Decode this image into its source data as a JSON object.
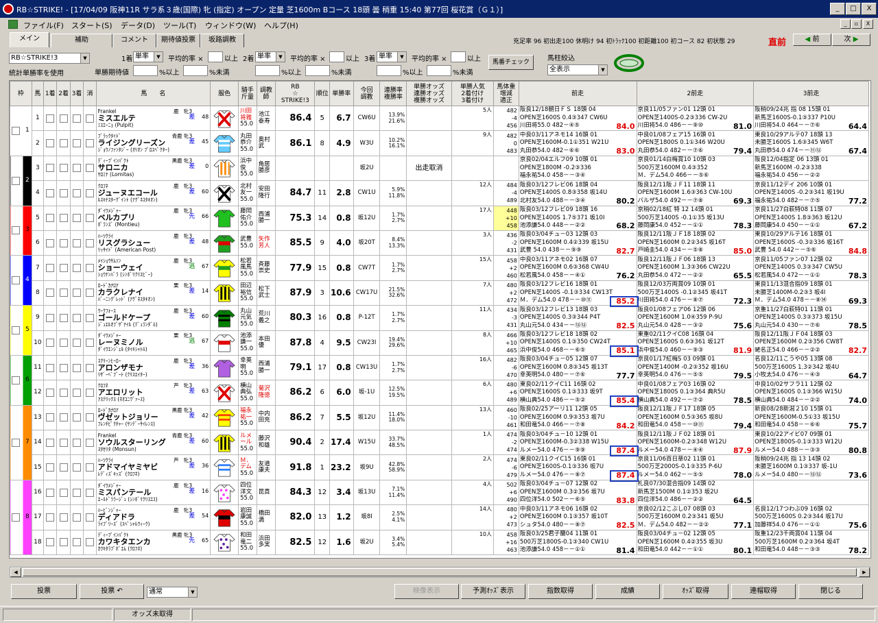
{
  "window": {
    "title": "RB☆STRIKE! - [17/04/09 阪神11R サラ系３歳(国際) 牝 (指定) オープン 定量 芝1600m Bコース 18頭 曇 稍重 15:40 第77回 桜花賞（Ｇ１）]",
    "min": "_",
    "max": "□",
    "close": "X"
  },
  "menu": [
    "ファイル(F)",
    "スタート(S)",
    "データ(D)",
    "ツール(T)",
    "ウィンドウ(W)",
    "ヘルプ(H)"
  ],
  "mdi": {
    "min": "_",
    "restore": "▫",
    "close": "X"
  },
  "tabs": [
    "メイン",
    "補助",
    "コメント",
    "期待値投票",
    "坂路調教"
  ],
  "stats": "充足率 96  初出走100 休明け 94  初ﾄﾗｯｸ100  初距離100  初コース 82  初状態 29",
  "chokuzen": "直前",
  "nav": {
    "prev": "前",
    "next": "次"
  },
  "controls": {
    "profile": "RB☆STRIKE!3",
    "stat_label": "統計単勝率を使用",
    "c1_label": "1着",
    "c1_sel": "単率",
    "c2_label": "2着",
    "c2_sel": "単率",
    "c3_label": "3着",
    "c3_sel": "単率",
    "avg_label": "平均的率 ×",
    "above": "以上",
    "tan_exp": "単勝期待値",
    "pct_above": "%以上",
    "pct_below": "%未満",
    "umaban_check": "馬番チェック",
    "filter_label": "馬柱絞込",
    "filter_value": "全表示"
  },
  "headers": [
    "枠",
    "馬",
    "1着",
    "2着",
    "3着",
    "消",
    "馬　　名",
    "服色",
    "騎手\n斤量",
    "調教\n師",
    "RB\n☆\nSTRIKE!3",
    "順位",
    "単勝率",
    "今回\n調教",
    "連勝率\n複勝率",
    "単勝オッズ\n連勝オッズ\n複勝オッズ",
    "単勝人気\n2着付け\n3着付け",
    "馬体重\n増減\n適正",
    "前走",
    "2前走",
    "3前走"
  ],
  "horses": [
    {
      "waku": "1",
      "ban": "1",
      "sire": "Frankel",
      "sexage": "鹿　牝3",
      "name": "ミスエルテ",
      "dam": "ﾐｽｴｰﾆｮ (Pulpit)",
      "style": "差",
      "ft": "48",
      "jockey": "川田\n将雅",
      "jred": true,
      "weight": "55.0",
      "trainer": "池江\n泰寿",
      "rb": "86.4",
      "jun": "5",
      "odds": "6.7",
      "chou": "CW6U",
      "rate": "13.9%\n21.6%",
      "cancel": "",
      "ninki": "5人",
      "bw": "482\n-4\n456",
      "bwy": false,
      "p1": [
        "阪良12/18朝日ＦＳ 18頭 04",
        "OPEN芝1600S 0.4③347 CW6U",
        "川田将55.0 482－④⑤ 84.0"
      ],
      "p1s": "84.0",
      "p1r": true,
      "p2": [
        "京良11/05ファン01 12頭 01",
        "OPEN芝1400S-0.2③336 CW-2U",
        "川田将54.0 486－－⑨⑩ 81.0"
      ],
      "p2s": "81.0",
      "p2r": false,
      "p3": [
        "阪稍09/24兆 指 08 15頭 01",
        "新馬芝1600S-0.1③337 P10U",
        "川田将54.0 464－－⑦⑥ 64.4"
      ],
      "p3s": "64.4",
      "p3r": false,
      "silk": "red-x"
    },
    {
      "waku": "1",
      "ban": "2",
      "sire": "ﾌﾞﾗｯｸﾀｲﾄﾞ",
      "sexage": "青鹿 牝3",
      "name": "ライジングリーズン",
      "dam": "ｼﾞｮｳﾉﾌｧﾝﾀｼﾞｰ (ｵﾘｵﾝ ﾌﾟﾛｽﾍﾟｸﾀｰ)",
      "style": "差",
      "ft": "45",
      "jockey": "丸田\n恭介",
      "jred": false,
      "weight": "55.0",
      "trainer": "奥村\n武",
      "rb": "86.1",
      "jun": "8",
      "odds": "4.9",
      "chou": "W3U",
      "rate": "10.2%\n16.1%",
      "cancel": "",
      "ninki": "9人",
      "bw": "482\n0\n483",
      "bwy": false,
      "p1": [
        "中良03/11アネモ14 16頭 01",
        "OPEN芝1600M-0.1①351 W21U",
        "丸田恭54.0 482－⑥⑥ 83.0"
      ],
      "p1s": "83.0",
      "p1r": true,
      "p2": [
        "中良01/08フェア15 16頭 01",
        "OPEN芝1800S 0.1①346 W20U",
        "丸田恭54.0 482－－⑦⑥ 79.4"
      ],
      "p2s": "79.4",
      "p2r": false,
      "p3": [
        "東良10/29アルテ07 18頭 13",
        "未勝芝1600S 1.6③345 W6T",
        "丸田恭54.0 474－－⑪⑫ 67.4"
      ],
      "p3s": "67.4",
      "p3r": false,
      "silk": "lightblue"
    },
    {
      "waku": "2",
      "ban": "3",
      "sire": "ﾃﾞｨｰﾌﾟｲﾝﾊﾟｸﾄ",
      "sexage": "黒鹿 牝3",
      "name": "サロニカ",
      "dam": "ｻﾛﾐﾅ (Lomitas)",
      "style": "差",
      "ft": "0",
      "jockey": "浜中\n俊",
      "jred": false,
      "weight": "55.0",
      "trainer": "角居\n勝彦",
      "rb": "",
      "jun": "",
      "odds": "",
      "chou": "坂2U",
      "rate": "",
      "cancel": "出走取消",
      "ninki": "",
      "bw": "",
      "bwy": false,
      "p1": [
        "京良02/04エルフ09 10頭 01",
        "OPEN芝1800M -0.2③336",
        "福永祐54.0 458－－③④"
      ],
      "p1s": "",
      "p1r": false,
      "p2": [
        "京良01/14白梅賞10 10頭 03",
        "500万芝1600M 0.4③352",
        "Ｍ．デム54.0 466－－⑤⑥"
      ],
      "p2s": "",
      "p2r": false,
      "p3": [
        "阪良12/04指定 06 13頭 01",
        "新馬芝1600M -0.2③338",
        "福永祐54.0 456－－②②"
      ],
      "p3s": "",
      "p3r": false,
      "silk": "orange-stripe"
    },
    {
      "waku": "2",
      "ban": "4",
      "sire": "ｸﾛﾌﾈ",
      "sexage": "鹿　牝3",
      "name": "ジューヌエコール",
      "dam": "ﾙｽｷﾅｽﾀｰｸﾞｲﾝﾄ (ｱｸﾞﾈｽﾀｷｵﾝ)",
      "style": "差",
      "ft": "60",
      "jockey": "北村\n友一",
      "jred": false,
      "weight": "55.0",
      "trainer": "安田\n隆行",
      "rb": "84.7",
      "jun": "11",
      "odds": "2.8",
      "chou": "CW1U",
      "rate": "5.9%\n11.8%",
      "cancel": "",
      "ninki": "12人",
      "bw": "484\n-4\n489",
      "bwy": false,
      "p1": [
        "阪良03/12フレビ06 18頭 04",
        "OPEN芝1400S 0.8③358 坂14U",
        "北村友54.0 488－－③④ 80.2"
      ],
      "p1s": "80.2",
      "p1r": false,
      "p2": [
        "阪良12/11阪ＪＦ11 18頭 11",
        "OPEN芝1600M 1.6③363 CW-10U",
        "バルザ54.0 492－－⑦⑧ 69.3"
      ],
      "p2s": "69.3",
      "p2r": false,
      "p3": [
        "京良11/12デイ 206 10頭 01",
        "OPEN芝1400S -0.2③341 坂19U",
        "福永祐54.0 482－－⑦⑤ 77.2"
      ],
      "p3s": "77.2",
      "p3r": false,
      "silk": "black-x"
    },
    {
      "waku": "3",
      "ban": "5",
      "sire": "ﾀﾞｲﾜﾒｼﾞｬｰ",
      "sexage": "鹿　牝3",
      "name": "ベルカプリ",
      "dam": "ﾎﾟﾗﾝｽﾞ (Montieu)",
      "style": "先",
      "ft": "66",
      "jockey": "藤岡\n佑介",
      "jred": false,
      "weight": "55.0",
      "trainer": "西浦\n勝一",
      "rb": "75.3",
      "jun": "14",
      "odds": "0.8",
      "chou": "坂12U",
      "rate": "1.7%\n2.7%",
      "cancel": "",
      "ninki": "17人",
      "bw": "448\n+10\n458",
      "bwy": true,
      "p1": [
        "阪良03/12フレビ09 18頭 16",
        "OPEN芝1400S 1.7⑤371 坂10I",
        "池添謙54.0 448－－②② 68.2"
      ],
      "p1s": "68.2",
      "p1r": false,
      "p2": [
        "京稍02/18紅 特 12 14頭 01",
        "500万芝1400S -0.1①35 坂13U",
        "藤岡康54.0 452－－①① 78.3"
      ],
      "p2s": "78.3",
      "p2r": false,
      "p3": [
        "京良11/27白萩特08 11頭 07",
        "OPEN芝1400S 1.8③363 坂12U",
        "藤岡康54.0 450－－①① 67.2"
      ],
      "p3s": "67.2",
      "p3r": false,
      "silk": "green"
    },
    {
      "waku": "3",
      "ban": "6",
      "sire": "ﾊｰﾂｸﾗｲ",
      "sexage": "鹿　牝3",
      "name": "リスグラシュー",
      "dam": "ﾘｯｻｲﾄﾞ (American Post)",
      "style": "差",
      "ft": "48",
      "jockey": "武豊",
      "jred": false,
      "weight": "55.0",
      "trainer": "矢作\n芳人",
      "tred": true,
      "rb": "85.5",
      "jun": "9",
      "odds": "4.0",
      "chou": "坂20T",
      "rate": "8.4%\n13.3%",
      "cancel": "",
      "ninki": "3人",
      "bw": "436\n-2\n431",
      "bwy": false,
      "p1": [
        "阪良03/04チュ－03 12頭 03",
        "OPEN芝1600M 0.4②339 坂15U",
        "武豊 54.0 438－－⑨⑨ 82.7"
      ],
      "p1s": "82.7",
      "p1r": true,
      "p2": [
        "阪良12/11阪ＪＦ18 18頭 02",
        "OPEN芝1600M 0.2②345 坂16T",
        "戸崎圭54.0 434－－⑤⑧ 85.0"
      ],
      "p2s": "85.0",
      "p2r": true,
      "p3": [
        "東良10/29アルテ16 18頭 01",
        "OPEN芝1600S -0.3②336 坂16T",
        "武豊 54.0 442－－⑤⑥ 84.8"
      ],
      "p3s": "84.8",
      "p3r": true,
      "silk": "green-red"
    },
    {
      "waku": "4",
      "ban": "7",
      "sire": "ﾒｲｼｮｳｻﾑｿﾝ",
      "sexage": "鹿　牝3",
      "name": "ショーウェイ",
      "dam": "ｼｮｳﾅﾝﾊﾞﾗ (ｼﾝﾎﾞﾘｸﾘｽﾋﾞｰ)",
      "style": "逃",
      "ft": "67",
      "jockey": "松若\n風馬",
      "jred": false,
      "weight": "55.0",
      "trainer": "斉藤\n崇史",
      "rb": "77.9",
      "jun": "15",
      "odds": "0.8",
      "chou": "CW7T",
      "rate": "1.7%\n2.7%",
      "cancel": "",
      "ninki": "15人",
      "bw": "458\n+2\n460",
      "bwy": false,
      "p1": [
        "中良03/11アネモ02 16頭 07",
        "OPEN芝1600M 0.6③368 CW4U",
        "松若風54.0 458－－④① 76.2"
      ],
      "p1s": "76.2",
      "p1r": false,
      "p2": [
        "阪良12/11阪ＪＦ06 18頭 13",
        "OPEN芝1600M 1.3③366 CW22U",
        "丸田恭54.0 472－－②② 65.5"
      ],
      "p2s": "65.5",
      "p2r": false,
      "p3": [
        "京良11/05ファン07 12頭 02",
        "OPEN芝1400S 0.3③347 CW5U",
        "松若風54.0 472－－①① 78.3"
      ],
      "p3s": "78.3",
      "p3r": false,
      "silk": "yellow-green"
    },
    {
      "waku": "4",
      "ban": "8",
      "sire": "ﾛｰﾄﾞｶﾅﾛｱ",
      "sexage": "栗　牝3",
      "name": "カラクレナイ",
      "dam": "ﾊﾞｰﾆﾝｸﾞﾚｯﾄﾞ (ｱｸﾞﾈｽﾀｷｵﾝ)",
      "style": "差",
      "ft": "14",
      "jockey": "田辺\n裕信",
      "jred": false,
      "weight": "55.0",
      "trainer": "松下\n武士",
      "rb": "87.9",
      "jun": "3",
      "odds": "10.6",
      "chou": "CW17U",
      "rate": "21.5%\n32.6%",
      "cancel": "",
      "ninki": "7人",
      "bw": "480\n+2\n472",
      "bwy": false,
      "p1": [
        "阪良03/12フレビ16 18頭 01",
        "OPEN芝1400S -0.1③334 CW13T",
        "Ｍ．デム54.0 478－－⑩⑪ 85.2"
      ],
      "p1s": "85.2",
      "p1r": true,
      "p2": [
        "阪良12/03万両賞09 10頭 01",
        "500万芝1400S -0.1②345 坂41T",
        "川田将54.0 476－－⑧⑦ 72.3"
      ],
      "p2s": "72.3",
      "p2r": false,
      "p3": [
        "東良11/13混合指09 18頭 01",
        "未勝芝1400M-0.2③3 坂4I",
        "Ｍ．デム54.0 478－－⑧⑭ 69.3"
      ],
      "p3s": "69.3",
      "p3r": false,
      "silk": "yellow-black"
    },
    {
      "waku": "5",
      "ban": "9",
      "sire": "ﾜｰｸﾌｫｰｽ",
      "sexage": "鹿　牝3",
      "name": "ゴールドケープ",
      "dam": "ｼﾞｭｴﾙｵﾌﾞｻﾞﾅｲﾙ (ﾃﾞｭﾗﾝﾀﾞﾙ)",
      "style": "差",
      "ft": "60",
      "jockey": "丸山\n元気",
      "jred": false,
      "weight": "55.0",
      "trainer": "荒川\n義之",
      "rb": "80.3",
      "jun": "16",
      "odds": "0.8",
      "chou": "P-12T",
      "rate": "1.7%\n2.7%",
      "cancel": "",
      "ninki": "11人",
      "bw": "434\n-3\n431",
      "bwy": false,
      "p1": [
        "阪良03/12フレビ13 18頭 03",
        "OPEN芝1400S 0.3③344 P4T",
        "丸山元54.0 434－－⑬⑫ 82.5"
      ],
      "p1s": "82.5",
      "p1r": true,
      "p2": [
        "阪良01/08フェア06 12頭 06",
        "OPEN芝1600M 1.0④359 P-9U",
        "丸山元54.0 428－－③② 75.6"
      ],
      "p2s": "75.6",
      "p2r": false,
      "p3": [
        "京重11/27白萩特01 11頭 01",
        "OPEN芝1400S 0.3③373 坂15U",
        "丸山元54.0 430－－⑦⑥ 78.5"
      ],
      "p3s": "78.5",
      "p3r": false,
      "silk": "green-x"
    },
    {
      "waku": "5",
      "ban": "10",
      "sire": "ﾀﾞｲﾜﾒｼﾞｬｰ",
      "sexage": "栗　牝3",
      "name": "レーヌミノル",
      "dam": "ﾀﾞｲﾜｴﾝｼﾞｪﾙ (ﾀｲｷｼｬﾄﾙ)",
      "style": "逃",
      "ft": "67",
      "jockey": "池添\n謙一",
      "jred": false,
      "weight": "55.0",
      "trainer": "本田\n優",
      "rb": "87.8",
      "jun": "4",
      "odds": "9.5",
      "chou": "CW23I",
      "rate": "19.4%\n29.6%",
      "cancel": "",
      "ninki": "8人",
      "bw": "466\n+10\n465",
      "bwy": false,
      "p1": [
        "阪良03/12フレビ18 18頭 02",
        "OPEN芝1400S 0.1③350 CW24T",
        "浜中俊54.0 468－－⑥⑤ 85.1"
      ],
      "p1s": "85.1",
      "p1r": true,
      "p2": [
        "東重02/11クイC08 16頭 04",
        "OPEN芝1600S 0.6③361 坂12T",
        "浜中俊54.0 460－－⑨③ 81.9"
      ],
      "p2s": "81.9",
      "p2r": true,
      "p3": [
        "阪良12/11阪ＪＦ04 18頭 03",
        "OPEN芝1600M 0.2③356 CW8T",
        "蛯名正54.0 466－－②② 82.7"
      ],
      "p3s": "82.7",
      "p3r": true,
      "silk": "white-red"
    },
    {
      "waku": "6",
      "ban": "11",
      "sire": "ｽｸﾘｰﾝﾋｰﾛｰ",
      "sexage": "鹿　牝3",
      "name": "アロンザモナ",
      "dam": "ﾘｻﾞｰﾍﾞﾌﾞｰﾄ (ｸﾘｽｴｲﾀｰ)",
      "style": "差",
      "ft": "36",
      "jockey": "幸英\n明",
      "jred": false,
      "weight": "55.0",
      "trainer": "西浦\n勝一",
      "rb": "79.1",
      "jun": "17",
      "odds": "0.8",
      "chou": "CW13U",
      "rate": "1.7%\n2.7%",
      "cancel": "",
      "ninki": "16人",
      "bw": "482\n-6\n470",
      "bwy": false,
      "p1": [
        "阪良03/04チュ－05 12頭 07",
        "OPEN芝1600M 0.8③345 坂13T",
        "幸英明54.0 480－－⑦⑥ 77.7"
      ],
      "p1s": "77.7",
      "p1r": false,
      "p2": [
        "京良01/17紅梅S 03 09頭 01",
        "OPEN芝1400M -0.2③352 坂16U",
        "幸英明54.0 476－－⑤⑤ 79.5"
      ],
      "p2s": "79.5",
      "p2r": false,
      "p3": [
        "名良12/11こうや05 13頭 08",
        "500万芝1600S 1.3②342 坂4U",
        "小牧太54.0 476－－④③ 64.7"
      ],
      "p3s": "64.7",
      "p3r": false,
      "silk": "purple"
    },
    {
      "waku": "6",
      "ban": "12",
      "sire": "ｸﾛﾌﾈ",
      "sexage": "芦　牝3",
      "name": "アエロリット",
      "dam": "ｱｽﾃﾘｯｸｽ (ﾈｵﾕﾆｳﾞｧｰｽ)",
      "style": "差",
      "ft": "63",
      "jockey": "横山\n典弘",
      "jred": false,
      "weight": "55.0",
      "trainer": "菊沢\n隆徳",
      "tred": true,
      "rb": "86.2",
      "jun": "6",
      "odds": "6.0",
      "chou": "坂-1U",
      "rate": "12.5%\n19.5%",
      "cancel": "",
      "ninki": "6人",
      "bw": "480\n+6\n489",
      "bwy": false,
      "p1": [
        "東良02/11クイC11 16頭 02",
        "OPEN芝1600S 0.1③333 坂9T",
        "横山典54.0 486－－⑤② 85.4"
      ],
      "p1s": "85.4",
      "p1r": true,
      "p2": [
        "中良01/08フェア03 16頭 02",
        "OPEN芝1800S 0.1③364 典R5U",
        "横山典54.0 492－－⑦② 78.5"
      ],
      "p2s": "78.5",
      "p2r": false,
      "p3": [
        "中良10/02サフラ11 12頭 02",
        "OPEN芝1600S 0.1③366 W15U",
        "横山典54.0 484－－②② 74.0"
      ],
      "p3s": "74.0",
      "p3r": false,
      "silk": "red-x2"
    },
    {
      "waku": "7",
      "ban": "13",
      "sire": "ﾛｰﾄﾞｶﾅﾛｱ",
      "sexage": "黒鹿 牝3",
      "name": "ヴゼットジョリー",
      "dam": "ﾌﾚﾝﾁﾋﾟｸﾁｬｰ (ｻﾝﾃﾞｰｻｲﾚﾝｽ)",
      "style": "差",
      "ft": "42",
      "jockey": "福永\n祐一",
      "jred": true,
      "weight": "55.0",
      "trainer": "中内\n田充",
      "rb": "86.2",
      "jun": "7",
      "odds": "5.5",
      "chou": "坂12U",
      "rate": "11.4%\n18.0%",
      "cancel": "",
      "ninki": "13人",
      "bw": "460\n-10\n461",
      "bwy": false,
      "p1": [
        "阪良02/25アーリ11 12頭 05",
        "OPEN芝1600M 0.9③353 坂7U",
        "和田竜54.0 466－－⑦⑧ 84.2"
      ],
      "p1s": "84.2",
      "p1r": true,
      "p2": [
        "阪良12/11阪ＪＦ17 18頭 05",
        "OPEN芝1600M 0.5③365 坂8U",
        "和田竜54.0 458－－⑩⑪ 79.4"
      ],
      "p2s": "79.4",
      "p2r": false,
      "p3": [
        "新良08/28新潟２10 15頭 01",
        "OPEN芝1600M-0.5①33 坂15U",
        "和田竜54.0 458－－⑥⑥ 75.7"
      ],
      "p3s": "75.7",
      "p3r": false,
      "silk": "yellow-orange"
    },
    {
      "waku": "7",
      "ban": "14",
      "sire": "Frankel",
      "sexage": "青鹿 牝3",
      "name": "ソウルスターリング",
      "dam": "ｽﾀｾﾘﾀ (Monsun)",
      "style": "差",
      "ft": "60",
      "jockey": "ルメ\nール",
      "jred": true,
      "weight": "55.0",
      "trainer": "藤沢\n和雄",
      "rb": "90.4",
      "jun": "2",
      "odds": "17.4",
      "chou": "W15U",
      "rate": "33.7%\n48.5%",
      "cancel": "",
      "ninki": "1人",
      "bw": "474\n-2\n474",
      "bwy": false,
      "p1": [
        "阪良03/04チュ－10 12頭 01",
        "OPEN芝1600M-0.3②338 W15U",
        "ルメー54.0 476－－⑨⑨ 87.4"
      ],
      "p1s": "87.4",
      "p1r": true,
      "p2": [
        "阪良12/11阪ＪＦ02 18頭 01",
        "OPEN芝1600M-0.2③348 W12U",
        "ルメー54.0 478－－④④ 87.9"
      ],
      "p2s": "87.9",
      "p2r": true,
      "p3": [
        "東良10/22アイビ07 09頭 01",
        "OPEN芝1800S-0.1③333 W12U",
        "ルメー54.0 488－－③③ 80.8"
      ],
      "p3s": "80.8",
      "p3r": false,
      "silk": "black-yellow"
    },
    {
      "waku": "7",
      "ban": "15",
      "sire": "ﾊｰﾂｸﾗｲ",
      "sexage": "芦　牝3",
      "name": "アドマイヤミヤビ",
      "dam": "ﾚﾃﾞｨｽﾞｷｯｽﾞ (ｸﾛﾌﾈ)",
      "style": "差",
      "ft": "36",
      "jockey": "Ｍ．\nデム",
      "jred": true,
      "weight": "55.0",
      "trainer": "友道\n康夫",
      "rb": "91.8",
      "jun": "1",
      "odds": "23.2",
      "chou": "坂9U",
      "rate": "42.8%\n58.9%",
      "cancel": "",
      "ninki": "2人",
      "bw": "474\n-6\n479",
      "bwy": false,
      "p1": [
        "東良02/11クイC15 16頭 01",
        "OPEN芝1600S-0.1③336 坂7U",
        "ルメー54.0 476－－⑧⑦ 87.4"
      ],
      "p1s": "87.4",
      "p1r": true,
      "p2": [
        "京良11/06百日草02 11頭 01",
        "500万芝2000S-0.1③335 P-6U",
        "ルメー54.0 462－－⑤⑤ 78.0"
      ],
      "p2s": "78.0",
      "p2r": false,
      "p3": [
        "阪稍09/24兆 指 13 14頭 02",
        "未勝芝1600M 0.1③337 坂-1U",
        "ルメー54.0 480－－⑬⑫ 73.6"
      ],
      "p3s": "73.6",
      "p3r": false,
      "silk": "blue-white"
    },
    {
      "waku": "8",
      "ban": "16",
      "sire": "ﾀﾞｲﾜﾒｼﾞｬｰ",
      "sexage": "鹿　牝3",
      "name": "ミスパンテール",
      "dam": "ｴｰﾙﾄﾞﾗﾗｰｼﾞｭ (ｼﾝﾎﾞﾘｸﾘｽｴｽ)",
      "style": "差",
      "ft": "16",
      "jockey": "四位\n洋文",
      "jred": false,
      "weight": "55.0",
      "trainer": "昆貢",
      "rb": "84.3",
      "jun": "12",
      "odds": "3.4",
      "chou": "坂13U",
      "rate": "7.1%\n11.4%",
      "cancel": "",
      "ninki": "4人",
      "bw": "502\n+6\n490",
      "bwy": false,
      "p1": [
        "阪良03/04チュ－07 12頭 02",
        "OPEN芝1600M 0.3②356 坂7U",
        "四位洋54.0 502－－⑥⑤ 83.8"
      ],
      "p1s": "83.8",
      "p1r": true,
      "p2": [
        "札良07/30混合指09 14頭 02",
        "新馬芝1500M 0.1②353 坂2U",
        "四位洋54.0 486－－②② 64.5"
      ],
      "p2s": "64.5",
      "p2r": false,
      "p3": [
        "",
        "",
        ""
      ],
      "p3s": "",
      "p3r": false,
      "silk": "pink-polka"
    },
    {
      "waku": "8",
      "ban": "17",
      "sire": "ﾊｰﾋﾞﾝｼﾞｬｰ",
      "sexage": "鹿　牝3",
      "name": "ディアドラ",
      "dam": "ﾗｲﾌﾞﾘｰｽﾞ (ｽﾍﾟｼｬﾙｳｨｰｸ)",
      "style": "差",
      "ft": "54",
      "jockey": "岩田\n康誠",
      "jred": false,
      "weight": "55.0",
      "trainer": "橋田\n満",
      "rb": "82.0",
      "jun": "13",
      "odds": "1.2",
      "chou": "坂8I",
      "rate": "2.5%\n4.1%",
      "cancel": "",
      "ninki": "14人",
      "bw": "480\n+2\n473",
      "bwy": false,
      "p1": [
        "中良03/11アネモ06 16頭 02",
        "OPEN芝1600M 0.1③357 坂10T",
        "シュタ54.0 480－－⑧⑦ 82.5"
      ],
      "p1s": "82.5",
      "p1r": true,
      "p2": [
        "京良02/12こぶし07 08頭 03",
        "500万芝1600M 0.2③341 坂5U",
        "Ｍ．デム54.0 482－－②② 77.1"
      ],
      "p2s": "77.1",
      "p2r": false,
      "p3": [
        "名良12/17つわぶ09 16頭 02",
        "500万芝1600S 0.2③344 坂17U",
        "加藤祥54.0 476－－①① 75.6"
      ],
      "p3s": "75.6",
      "p3r": false,
      "silk": "red-black"
    },
    {
      "waku": "8",
      "ban": "18",
      "sire": "ﾃﾞｨｰﾌﾟｲﾝﾊﾟｸﾄ",
      "sexage": "黒鹿 牝3",
      "name": "カワキタエンカ",
      "dam": "ｶﾜｷﾀﾗﾌﾞﾎﾟｴﾑ (ｸﾛﾌﾈ)",
      "style": "先",
      "ft": "65",
      "jockey": "和田\n竜二",
      "jred": false,
      "weight": "55.0",
      "trainer": "浜田\n多実",
      "rb": "82.5",
      "jun": "12",
      "odds": "1.6",
      "chou": "坂2U",
      "rate": "3.4%\n5.4%",
      "cancel": "",
      "ninki": "10人",
      "bw": "458\n+16\n463",
      "bwy": false,
      "p1": [
        "阪良03/25君子蘭04 11頭 01",
        "500万芝1800S-0.1③340 CW1U",
        "池添謙54.0 458－－①① 81.4"
      ],
      "p1s": "81.4",
      "p1r": false,
      "p2": [
        "阪良03/04チュ－02 12頭 05",
        "OPEN芝1600M 0.4②355 坂3U",
        "和田竜54.0 442－－①① 80.1"
      ],
      "p2s": "80.1",
      "p2r": false,
      "p3": [
        "阪重12/23千両賞04 11頭 04",
        "500万芝1600M 0.2③364 坂4T",
        "和田竜54.0 448－－③③ 78.2"
      ],
      "p3s": "78.2",
      "p3r": false,
      "silk": "purple-yellow"
    }
  ],
  "waku_colors": {
    "1": "#ffffff",
    "2": "#000000",
    "3": "#ff0000",
    "4": "#0000ff",
    "5": "#ffff00",
    "6": "#00a000",
    "7": "#ff8c00",
    "8": "#ff40ff"
  },
  "bottom": {
    "buttons": [
      "投票",
      "投票 ↶",
      "映像表示",
      "予測ｵｯｽﾞ表示",
      "指数取得",
      "成績",
      "ｵｯｽﾞ取得",
      "連帽取得",
      "閉じる"
    ],
    "select": "通常"
  },
  "status": {
    "odds": "オッズ未取得"
  }
}
